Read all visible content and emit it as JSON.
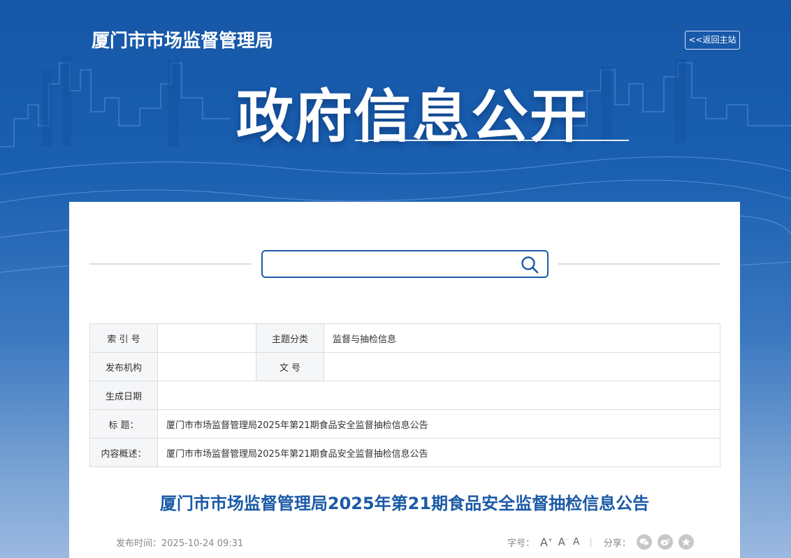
{
  "header": {
    "site_title": "厦门市市场监督管理局",
    "back_label": "<<返回主站",
    "banner_title": "政府信息公开"
  },
  "search": {
    "placeholder": ""
  },
  "meta": {
    "index_no_label": "索 引 号",
    "index_no_value": "",
    "topic_label": "主题分类",
    "topic_value": "监督与抽检信息",
    "publisher_label": "发布机构",
    "publisher_value": "",
    "doc_no_label": "文 号",
    "doc_no_value": "",
    "created_label": "生成日期",
    "created_value": "",
    "title_label": "标 题：",
    "title_value": "厦门市市场监督管理局2025年第21期食品安全监督抽检信息公告",
    "summary_label": "内容概述：",
    "summary_value": "厦门市市场监督管理局2025年第21期食品安全监督抽检信息公告"
  },
  "article": {
    "title": "厦门市市场监督管理局2025年第21期食品安全监督抽检信息公告",
    "publish_time": "发布时间：2025-10-24 09:31",
    "font_size_label": "字号：",
    "font_large": "A",
    "font_medium": "A",
    "font_small": "A",
    "share_label": "分享："
  },
  "icons": {
    "search": "search-icon",
    "wechat": "wechat-icon",
    "weibo": "weibo-icon",
    "favorite": "star-icon"
  },
  "colors": {
    "brand_blue": "#1b5aa6",
    "header_blue": "#1657a8"
  }
}
